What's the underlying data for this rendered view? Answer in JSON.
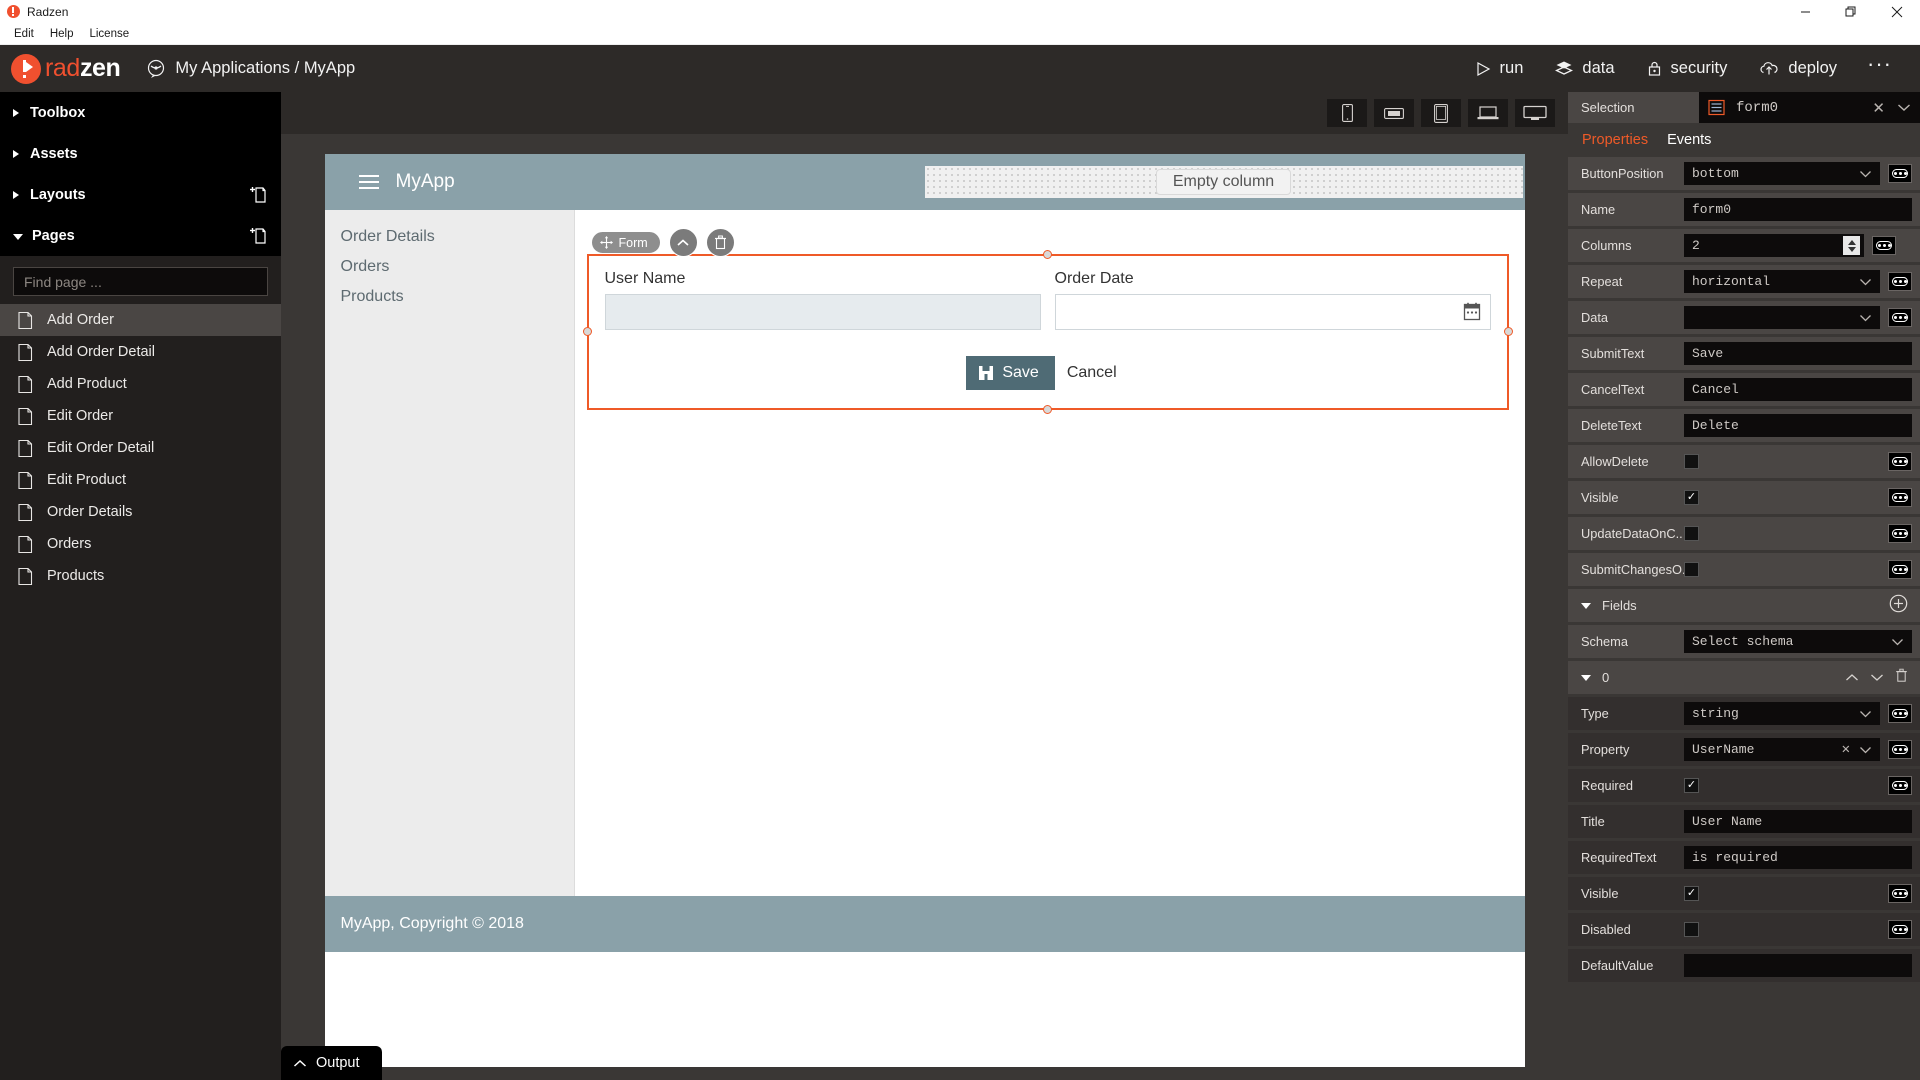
{
  "window": {
    "title": "Radzen",
    "controls": {
      "minimize": "minimize-icon",
      "maximize": "maximize-icon",
      "close": "close-icon"
    }
  },
  "menubar": {
    "items": [
      "Edit",
      "Help",
      "License"
    ]
  },
  "header": {
    "brand_rad": "rad",
    "brand_zen": "zen",
    "breadcrumb": "My Applications / MyApp",
    "actions": [
      {
        "label": "run",
        "icon": "play-icon"
      },
      {
        "label": "data",
        "icon": "layers-icon"
      },
      {
        "label": "security",
        "icon": "lock-icon"
      },
      {
        "label": "deploy",
        "icon": "cloud-upload-icon"
      }
    ],
    "more": "···"
  },
  "sidebar": {
    "sections": [
      {
        "label": "Toolbox",
        "expanded": false,
        "add": false
      },
      {
        "label": "Assets",
        "expanded": false,
        "add": false
      },
      {
        "label": "Layouts",
        "expanded": false,
        "add": true
      },
      {
        "label": "Pages",
        "expanded": true,
        "add": true
      }
    ],
    "search_placeholder": "Find page ...",
    "search_value": "",
    "pages": [
      {
        "label": "Add Order",
        "selected": true
      },
      {
        "label": "Add Order Detail",
        "selected": false
      },
      {
        "label": "Add Product",
        "selected": false
      },
      {
        "label": "Edit Order",
        "selected": false
      },
      {
        "label": "Edit Order Detail",
        "selected": false
      },
      {
        "label": "Edit Product",
        "selected": false
      },
      {
        "label": "Order Details",
        "selected": false
      },
      {
        "label": "Orders",
        "selected": false
      },
      {
        "label": "Products",
        "selected": false
      }
    ]
  },
  "devicebar": {
    "buttons": [
      "phone-portrait-icon",
      "phone-landscape-icon",
      "tablet-icon",
      "laptop-icon",
      "desktop-icon"
    ]
  },
  "canvas": {
    "app_title": "MyApp",
    "menu_icon": "hamburger-icon",
    "empty_column_label": "Empty column",
    "nav": [
      "Order Details",
      "Orders",
      "Products"
    ],
    "widget_toolbar": {
      "chip_label": "Form",
      "move_icon": "move-icon",
      "up_icon": "chevron-up-icon",
      "delete_icon": "trash-icon"
    },
    "form": {
      "fields": [
        {
          "label": "User Name",
          "value": "",
          "type": "text"
        },
        {
          "label": "Order Date",
          "value": "",
          "type": "date",
          "icon": "calendar-icon"
        }
      ],
      "submit_label": "Save",
      "submit_icon": "save-icon",
      "cancel_label": "Cancel"
    },
    "footer": "MyApp, Copyright © 2018"
  },
  "output": {
    "label": "Output",
    "icon": "chevron-up-icon"
  },
  "properties_panel": {
    "selection_label": "Selection",
    "selection_value": "form0",
    "selection_icon": "form-icon",
    "clear_icon": "close-icon",
    "dropdown_icon": "chevron-down-icon",
    "tabs": [
      {
        "label": "Properties",
        "active": true
      },
      {
        "label": "Events",
        "active": false
      }
    ],
    "rows": [
      {
        "name": "ButtonPosition",
        "type": "select",
        "value": "bottom",
        "code": true
      },
      {
        "name": "Name",
        "type": "text",
        "value": "form0",
        "code": false
      },
      {
        "name": "Columns",
        "type": "spinner",
        "value": "2",
        "code": true
      },
      {
        "name": "Repeat",
        "type": "select",
        "value": "horizontal",
        "code": true
      },
      {
        "name": "Data",
        "type": "select",
        "value": "",
        "code": true
      },
      {
        "name": "SubmitText",
        "type": "text",
        "value": "Save",
        "code": false
      },
      {
        "name": "CancelText",
        "type": "text",
        "value": "Cancel",
        "code": false
      },
      {
        "name": "DeleteText",
        "type": "text",
        "value": "Delete",
        "code": false
      },
      {
        "name": "AllowDelete",
        "type": "checkbox",
        "checked": false,
        "code": true
      },
      {
        "name": "Visible",
        "type": "checkbox",
        "checked": true,
        "code": true
      },
      {
        "name": "UpdateDataOnC..",
        "type": "checkbox",
        "checked": false,
        "code": true
      },
      {
        "name": "SubmitChangesO..",
        "type": "checkbox",
        "checked": false,
        "code": true
      }
    ],
    "fields_section": {
      "label": "Fields",
      "add_icon": "plus-circle-icon",
      "expanded": true
    },
    "schema_row": {
      "name": "Schema",
      "value": "Select schema"
    },
    "field_index": {
      "index": "0",
      "up_icon": "chevron-up-icon",
      "down_icon": "chevron-down-icon",
      "delete_icon": "trash-icon"
    },
    "field_rows": [
      {
        "name": "Type",
        "type": "select",
        "value": "string",
        "code": true
      },
      {
        "name": "Property",
        "type": "select-clear",
        "value": "UserName",
        "code": true
      },
      {
        "name": "Required",
        "type": "checkbox",
        "checked": true,
        "code": true
      },
      {
        "name": "Title",
        "type": "text",
        "value": "User Name",
        "code": false
      },
      {
        "name": "RequiredText",
        "type": "text",
        "value": "is required",
        "code": false
      },
      {
        "name": "Visible",
        "type": "checkbox",
        "checked": true,
        "code": true
      },
      {
        "name": "Disabled",
        "type": "checkbox",
        "checked": false,
        "code": true
      },
      {
        "name": "DefaultValue",
        "type": "text",
        "value": "",
        "code": false
      }
    ]
  },
  "colors": {
    "accent": "#ef5a28",
    "chrome_dark": "#2d2a28",
    "panel": "#3a3735",
    "row": "#4a4644",
    "canvas_bar": "#8aa1a9",
    "save_button": "#4f6b75"
  }
}
